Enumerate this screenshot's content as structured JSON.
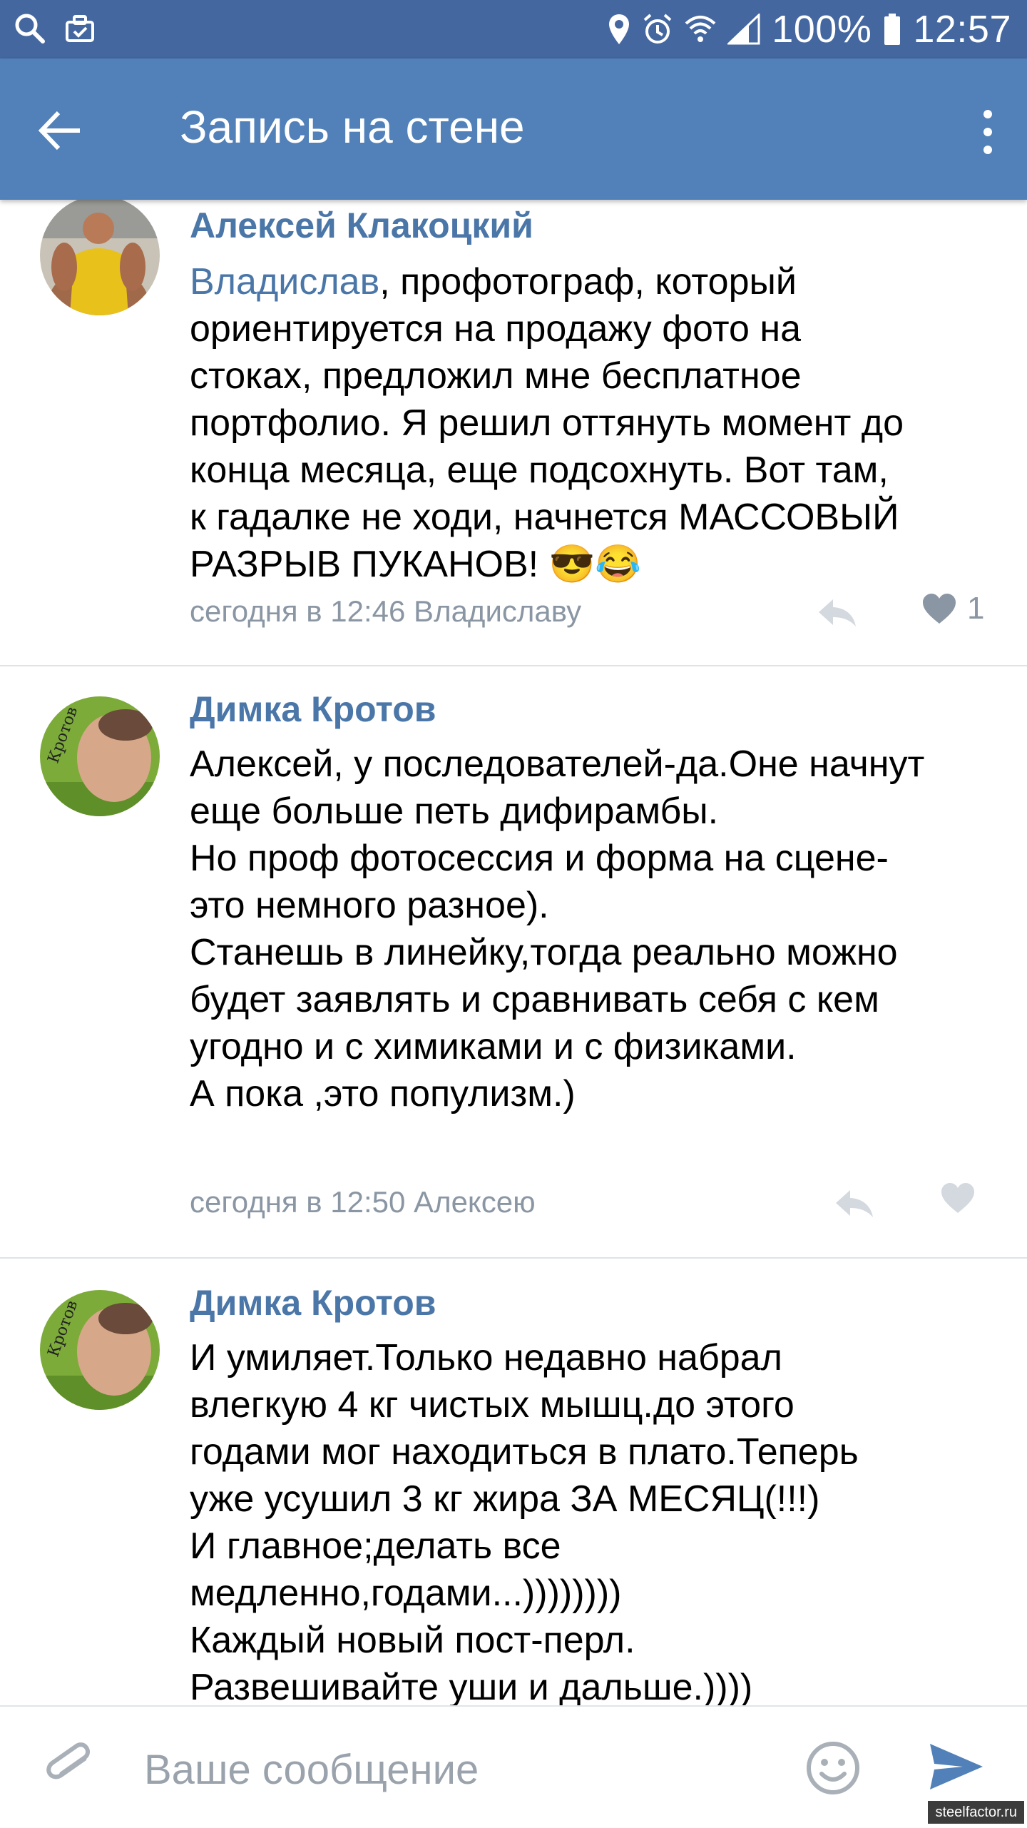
{
  "status_bar": {
    "battery_percent": "100%",
    "time": "12:57"
  },
  "app_bar": {
    "title": "Запись на стене"
  },
  "comments": [
    {
      "author": "Алексей Клакоцкий",
      "mention": "Владислав",
      "text": ", профотограф, который\nориентируется на продажу фото на\nстоках, предложил мне бесплатное\nпортфолио. Я решил оттянуть момент до\nконца месяца, еще подсохнуть. Вот там,\nк гадалке не ходи, начнется МАССОВЫЙ\nРАЗРЫВ ПУКАНОВ! 😎😂",
      "meta": "сегодня в 12:46 Владиславу",
      "like_count": "1"
    },
    {
      "author": "Димка Кротов",
      "text": "Алексей, у последователей-да.Оне начнут\nеще больше петь дифирамбы.\nНо проф фотосессия и форма на сцене-\nэто немного разное).\nСтанешь в линейку,тогда реально можно\nбудет заявлять и сравнивать себя с кем\nугодно и с химиками и с физиками.\nА пока ,это популизм.)",
      "meta": "сегодня в 12:50 Алексею",
      "like_count": ""
    },
    {
      "author": "Димка Кротов",
      "text": "И умиляет.Только недавно набрал\nвлегкую 4 кг чистых мышц.до этого\nгодами мог находиться в плато.Теперь\nуже усушил 3 кг жира ЗА МЕСЯЦ(!!!)\nИ главное;делать все\nмедленно,годами...))))))))\nКаждый новый пост-перл.\nРазвешивайте уши и дальше.))))"
    }
  ],
  "input": {
    "placeholder": "Ваше сообщение"
  },
  "watermark": "steelfactor.ru",
  "colors": {
    "status_bar": "#4467a0",
    "app_bar": "#5181b8",
    "link": "#4a76a8",
    "meta": "#8a96a3"
  }
}
